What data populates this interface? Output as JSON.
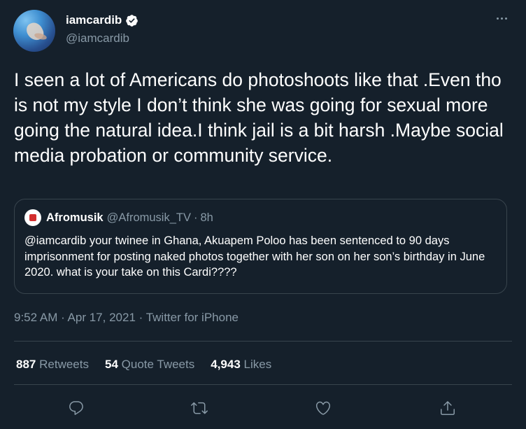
{
  "author": {
    "display_name": "iamcardib",
    "handle": "@iamcardib",
    "verified": true
  },
  "tweet": {
    "text": "I seen a lot of Americans do photoshoots like that .Even tho is not my style I don’t think she was going for sexual more going the natural idea.I think jail is a bit harsh .Maybe social media probation or community service."
  },
  "quoted_tweet": {
    "display_name": "Afromusik",
    "handle": "@Afromusik_TV",
    "separator": "·",
    "time": "8h",
    "text": "@iamcardib your twinee in Ghana, Akuapem Poloo has been sentenced to 90 days imprisonment for posting naked photos together with her son on her son’s birthday in June 2020.  what is your take on this Cardi????"
  },
  "meta": {
    "timestamp": "9:52 AM · Apr 17, 2021 · Twitter for iPhone"
  },
  "stats": [
    {
      "count": "887",
      "label": "Retweets"
    },
    {
      "count": "54",
      "label": "Quote Tweets"
    },
    {
      "count": "4,943",
      "label": "Likes"
    }
  ],
  "actions": [
    {
      "icon": "reply-icon"
    },
    {
      "icon": "retweet-icon"
    },
    {
      "icon": "like-icon"
    },
    {
      "icon": "share-icon"
    }
  ],
  "colors": {
    "background": "#15202b",
    "text": "#ffffff",
    "secondary": "#8899a6",
    "border": "#38444d",
    "verified": "#1da1f2"
  }
}
